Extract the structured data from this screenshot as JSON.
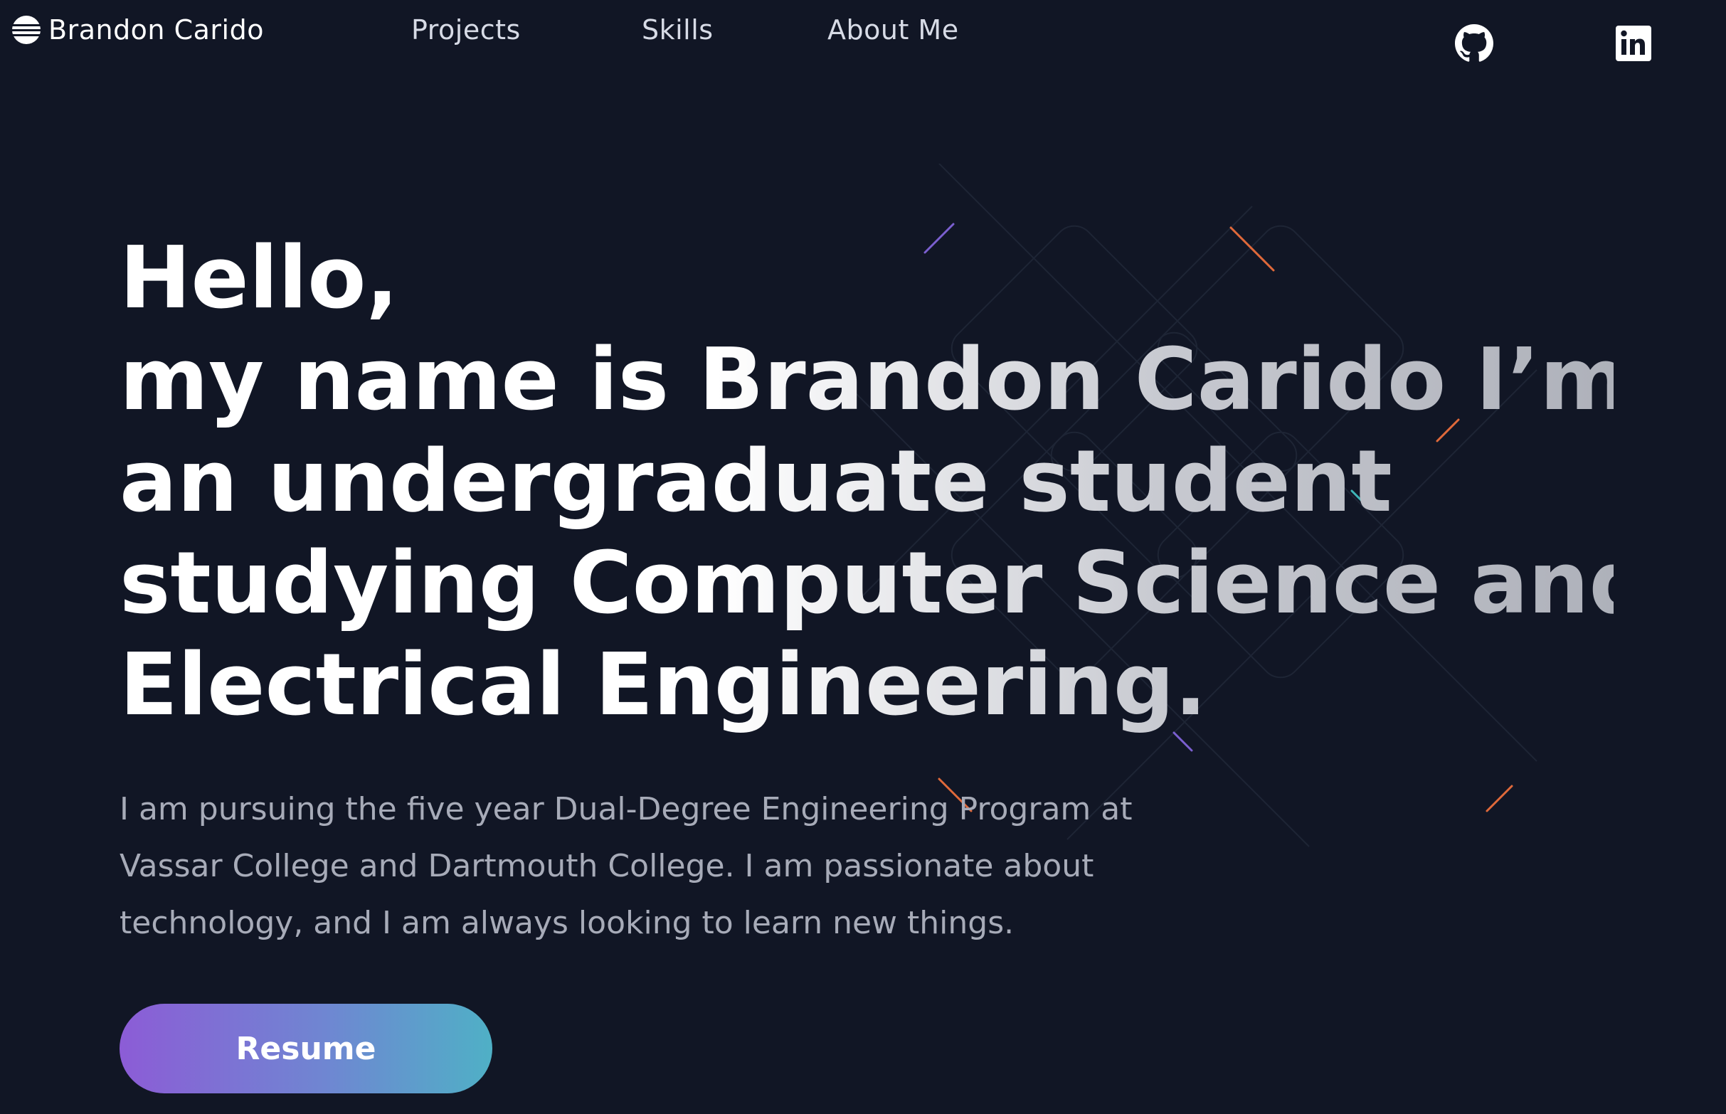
{
  "brand": {
    "name": "Brandon Carido"
  },
  "nav": {
    "items": [
      {
        "label": "Projects"
      },
      {
        "label": "Skills"
      },
      {
        "label": "About Me"
      }
    ]
  },
  "social": {
    "github_icon": "github-icon",
    "linkedin_icon": "linkedin-icon"
  },
  "hero": {
    "heading_lines": [
      "Hello,",
      "my name is Brandon Carido I’m",
      "an undergraduate student",
      "studying Computer Science and",
      "Electrical Engineering."
    ],
    "description": "I am pursuing the five year Dual-Degree Engineering Program at Vassar College and Dartmouth College. I am passionate about technology, and I am always looking to learn new things.",
    "resume_label": "Resume"
  },
  "colors": {
    "background": "#111625",
    "button_gradient_start": "#8c5cd6",
    "button_gradient_end": "#4fb0c6",
    "description_text": "#a7abb8"
  }
}
